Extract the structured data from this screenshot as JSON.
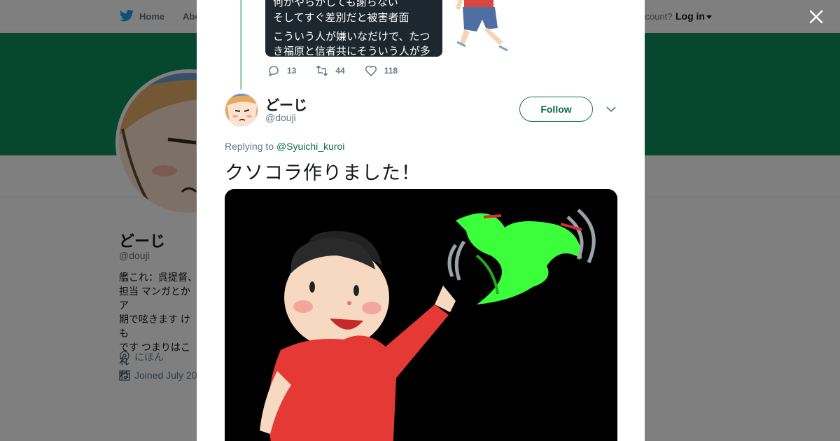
{
  "topnav": {
    "home_label": "Home",
    "about_label": "Abo",
    "account_label": "ccount?",
    "login_label": "Log in"
  },
  "profile": {
    "name": "どーじ",
    "handle": "@douji",
    "bio": "艦これ：呉提督、\n担当 マンガとかア\n期で呟きます けも\nです つまりはこれ\nね",
    "location": "にほん",
    "joined": "Joined July 20"
  },
  "modal": {
    "quoted_image_lines": [
      "何かやらかしても謝らない",
      "そしてすぐ差別だと被害者面",
      "こういう人が嫌いなだけで、たつ",
      "き福原と信者共にそういう人が多"
    ],
    "actions": {
      "replies": "13",
      "retweets": "44",
      "likes": "118"
    },
    "tweet": {
      "author_name": "どーじ",
      "author_handle": "@douji",
      "follow_label": "Follow",
      "replying_prefix": "Replying to ",
      "replying_to": "@Syuichi_kuroi",
      "text": "クソコラ作りました！"
    }
  },
  "colors": {
    "accent": "#0b6e4a",
    "banner": "#0b8f5f",
    "thread_line": "#a9d6c4",
    "croc": "#3cff3c"
  },
  "icons": [
    "twitter-bird-icon",
    "close-icon",
    "reply-icon",
    "retweet-icon",
    "like-icon",
    "chevron-down-icon",
    "location-icon",
    "calendar-icon"
  ]
}
